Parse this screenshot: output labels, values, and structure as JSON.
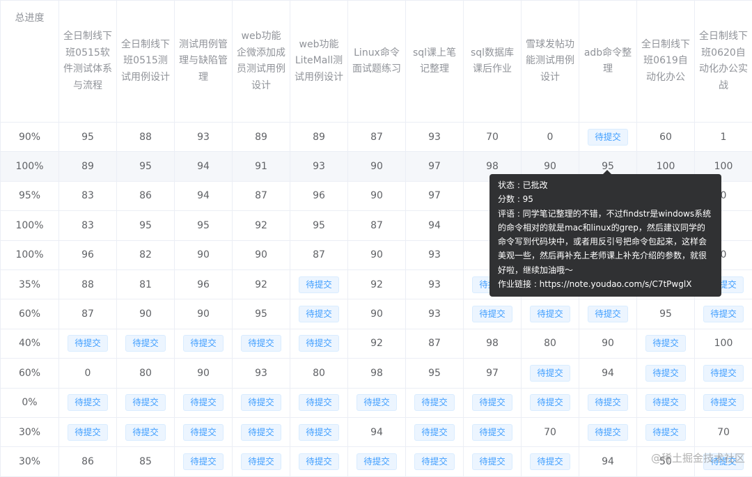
{
  "table": {
    "headers": [
      "总进度",
      "全日制线下班0515软件测试体系与流程",
      "全日制线下班0515测试用例设计",
      "测试用例管理与缺陷管理",
      "web功能企微添加成员测试用例设计",
      "web功能LiteMall测试用例设计",
      "Linux命令面试题练习",
      "sql课上笔记整理",
      "sql数据库课后作业",
      "雪球发帖功能测试用例设计",
      "adb命令整理",
      "全日制线下班0619自动化办公",
      "全日制线下班0620自动化办公实战"
    ],
    "pending_label": "待提交",
    "rows": [
      [
        "90%",
        "95",
        "88",
        "93",
        "89",
        "89",
        "87",
        "93",
        "70",
        "0",
        "P",
        "60",
        "1"
      ],
      [
        "100%",
        "89",
        "95",
        "94",
        "91",
        "93",
        "90",
        "97",
        "98",
        "90",
        "95",
        "100",
        "100"
      ],
      [
        "95%",
        "83",
        "86",
        "94",
        "87",
        "96",
        "90",
        "97",
        "8",
        "",
        "",
        "",
        "0"
      ],
      [
        "100%",
        "83",
        "95",
        "95",
        "92",
        "95",
        "87",
        "94",
        "8",
        "",
        "",
        "",
        ""
      ],
      [
        "100%",
        "96",
        "82",
        "90",
        "90",
        "87",
        "90",
        "93",
        "9",
        "",
        "",
        "",
        "0"
      ],
      [
        "35%",
        "88",
        "81",
        "96",
        "92",
        "P",
        "92",
        "93",
        "P",
        "",
        "",
        "",
        "P"
      ],
      [
        "60%",
        "87",
        "90",
        "90",
        "95",
        "P",
        "90",
        "93",
        "P",
        "P",
        "P",
        "95",
        "P"
      ],
      [
        "40%",
        "P",
        "P",
        "P",
        "P",
        "P",
        "92",
        "87",
        "98",
        "80",
        "90",
        "P",
        "100"
      ],
      [
        "60%",
        "0",
        "80",
        "90",
        "93",
        "80",
        "98",
        "95",
        "97",
        "P",
        "94",
        "P",
        "P"
      ],
      [
        "0%",
        "P",
        "P",
        "P",
        "P",
        "P",
        "P",
        "P",
        "P",
        "P",
        "P",
        "P",
        "P"
      ],
      [
        "30%",
        "P",
        "P",
        "P",
        "P",
        "P",
        "94",
        "P",
        "P",
        "70",
        "P",
        "P",
        "70"
      ],
      [
        "30%",
        "86",
        "85",
        "P",
        "P",
        "P",
        "P",
        "P",
        "P",
        "P",
        "94",
        "50",
        "P"
      ]
    ]
  },
  "tooltip": {
    "status": "状态 : 已批改",
    "score": "分数 : 95",
    "comment": "评语 : 同学笔记整理的不错，不过findstr是windows系统的命令相对的就是mac和linux的grep，然后建议同学的命令写到代码块中，或者用反引号把命令包起来，这样会美观一些，然后再补充上老师课上补充介绍的参数，就很好啦，继续加油哦～",
    "link": "作业链接 : https://note.youdao.com/s/C7tPwglX"
  },
  "watermark": "@稀土掘金技术社区"
}
